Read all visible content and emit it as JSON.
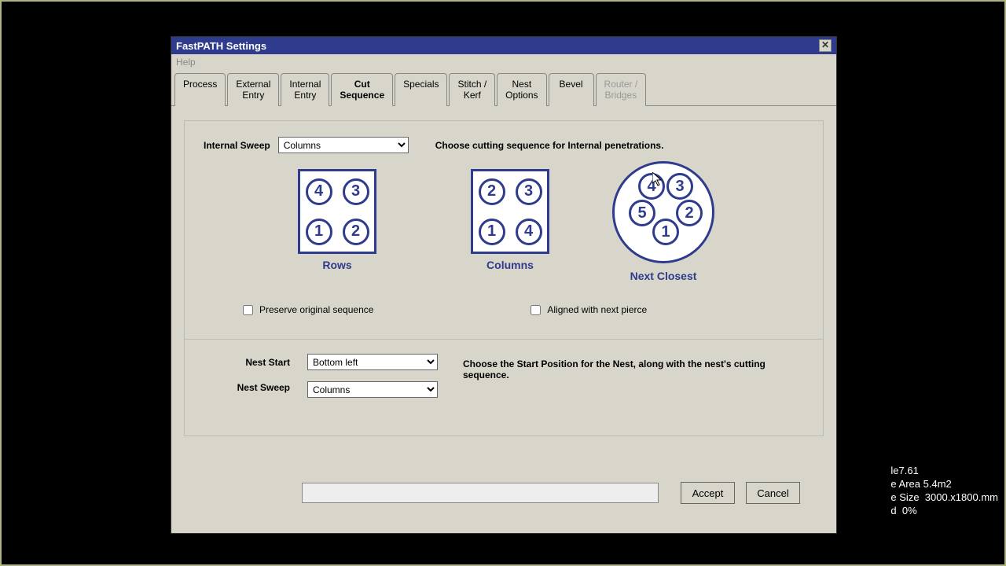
{
  "window": {
    "title": "FastPATH Settings",
    "menu": "Help"
  },
  "tabs": [
    "Process",
    "External\nEntry",
    "Internal\nEntry",
    "Cut\nSequence",
    "Specials",
    "Stitch /\nKerf",
    "Nest\nOptions",
    "Bevel",
    "Router /\nBridges"
  ],
  "internalSweep": {
    "label": "Internal Sweep",
    "value": "Columns",
    "hint": "Choose cutting sequence for Internal penetrations."
  },
  "diagrams": {
    "rows": {
      "label": "Rows",
      "cells": [
        "4",
        "3",
        "1",
        "2"
      ]
    },
    "cols": {
      "label": "Columns",
      "cells": [
        "2",
        "3",
        "1",
        "4"
      ]
    },
    "next": {
      "label": "Next Closest",
      "cells": [
        "4",
        "3",
        "5",
        "2",
        "1"
      ]
    }
  },
  "checkboxes": {
    "preserve": "Preserve original sequence",
    "aligned": "Aligned with next pierce"
  },
  "nest": {
    "startLabel": "Nest Start",
    "startValue": "Bottom left",
    "sweepLabel": "Nest Sweep",
    "sweepValue": "Columns",
    "hint": "Choose the Start Position for the Nest, along with the nest's cutting sequence."
  },
  "buttons": {
    "accept": "Accept",
    "cancel": "Cancel"
  },
  "bgStatus": "le7.61\ne Area 5.4m2\ne Size  3000.x1800.mm\nd  0%"
}
